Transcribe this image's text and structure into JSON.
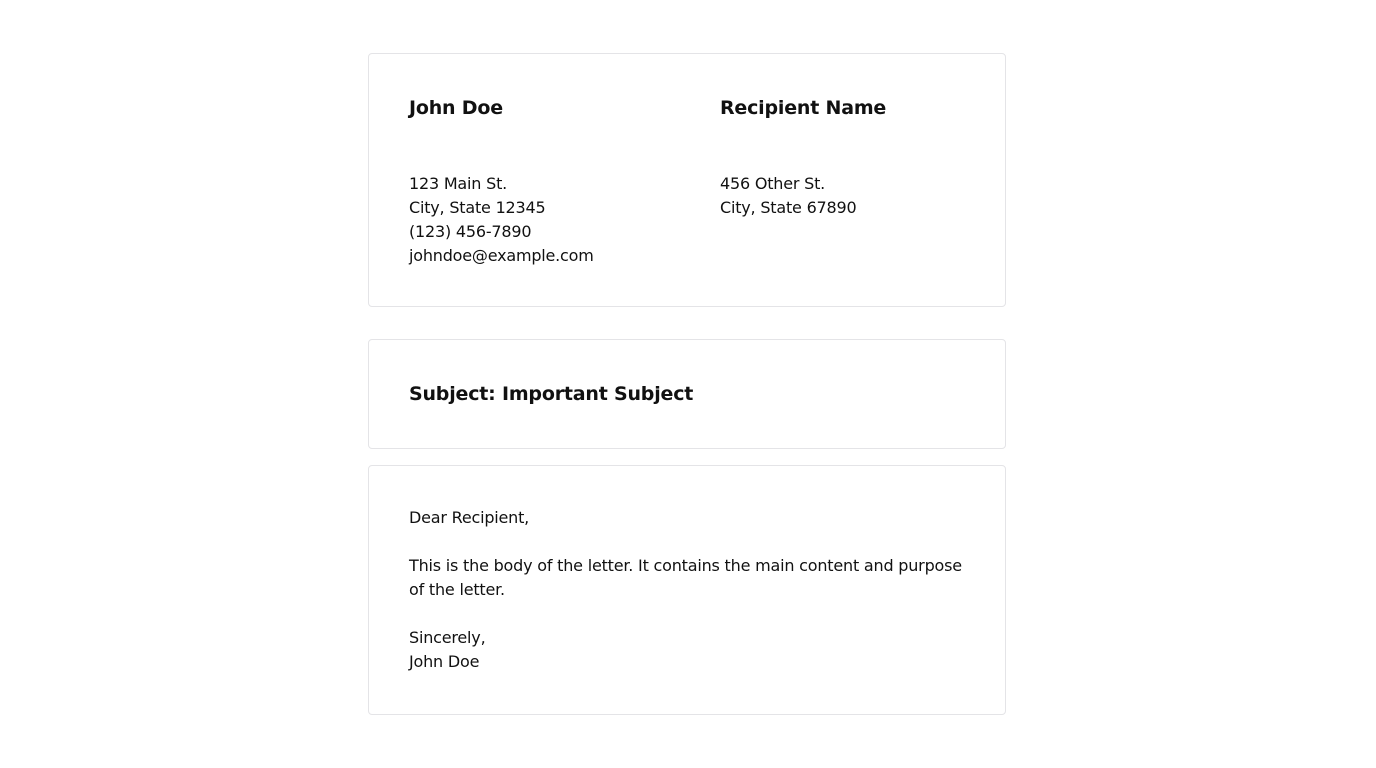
{
  "sender": {
    "name": "John Doe",
    "address_lines": [
      "123 Main St.",
      "City, State 12345",
      "(123) 456-7890",
      "johndoe@example.com"
    ]
  },
  "recipient": {
    "name": "Recipient Name",
    "address_lines": [
      "456 Other St.",
      "City, State 67890"
    ]
  },
  "subject": "Subject: Important Subject",
  "letter": {
    "salutation": "Dear Recipient,",
    "body": "This is the body of the letter. It contains the main content and purpose of the letter.",
    "closing": "Sincerely,",
    "signature": "John Doe"
  }
}
